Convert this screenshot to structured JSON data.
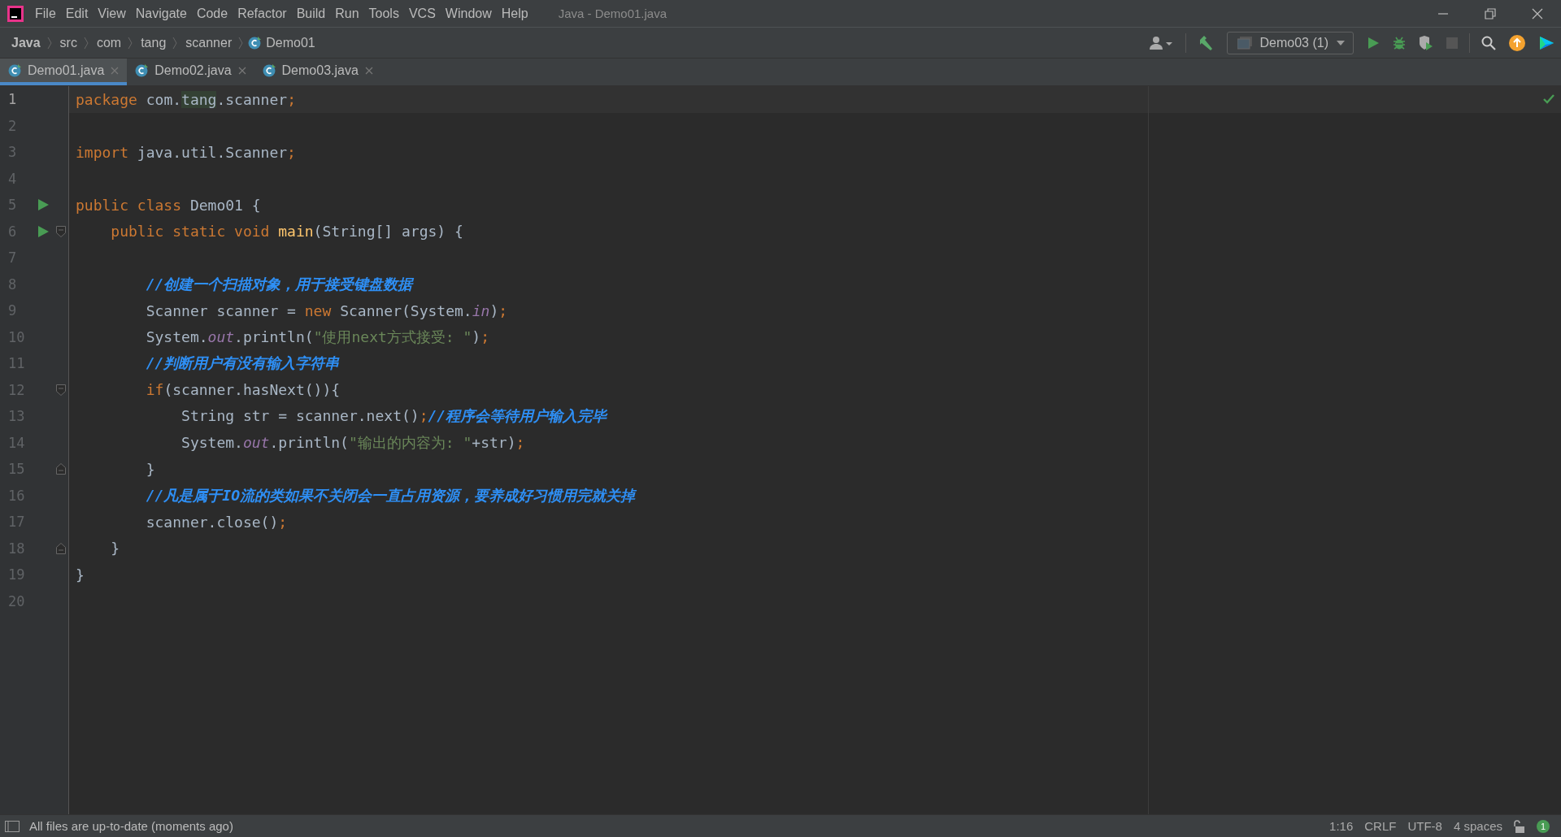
{
  "menu": [
    "File",
    "Edit",
    "View",
    "Navigate",
    "Code",
    "Refactor",
    "Build",
    "Run",
    "Tools",
    "VCS",
    "Window",
    "Help"
  ],
  "window": {
    "title": "Java - Demo01.java"
  },
  "breadcrumbs": [
    {
      "label": "Java",
      "kind": "project"
    },
    {
      "label": "src",
      "kind": "folder"
    },
    {
      "label": "com",
      "kind": "folder"
    },
    {
      "label": "tang",
      "kind": "folder"
    },
    {
      "label": "scanner",
      "kind": "folder"
    },
    {
      "label": "Demo01",
      "kind": "class"
    }
  ],
  "toolbar": {
    "run_config": "Demo03 (1)",
    "stop_disabled": true
  },
  "tabs": [
    {
      "label": "Demo01.java",
      "selected": true
    },
    {
      "label": "Demo02.java",
      "selected": false
    },
    {
      "label": "Demo03.java",
      "selected": false
    }
  ],
  "lines": [
    {
      "number": "1",
      "current": true,
      "tokens": [
        {
          "kind": "kw",
          "text": "package "
        },
        {
          "kind": "plain",
          "text": "com."
        },
        {
          "kind": "match",
          "text": "tang"
        },
        {
          "kind": "plain",
          "text": ".scanner"
        },
        {
          "kind": "semi",
          "text": ";"
        }
      ]
    },
    {
      "number": "2"
    },
    {
      "number": "3",
      "tokens": [
        {
          "kind": "kw",
          "text": "import "
        },
        {
          "kind": "plain",
          "text": "java.util.Scanner"
        },
        {
          "kind": "semi",
          "text": ";"
        }
      ]
    },
    {
      "number": "4"
    },
    {
      "number": "5",
      "run_marker": true,
      "tokens": [
        {
          "kind": "kw",
          "text": "public class "
        },
        {
          "kind": "plain",
          "text": "Demo01 {"
        }
      ]
    },
    {
      "number": "6",
      "run_marker": true,
      "fold_start": true,
      "tokens": [
        {
          "kind": "kw",
          "text": "    public static void "
        },
        {
          "kind": "method",
          "text": "main"
        },
        {
          "kind": "plain",
          "text": "(String[] args) {"
        }
      ]
    },
    {
      "number": "7"
    },
    {
      "number": "8",
      "tokens": [
        {
          "kind": "comment",
          "text": "        //创建一个扫描对象，用于接受键盘数据"
        }
      ]
    },
    {
      "number": "9",
      "tokens": [
        {
          "kind": "plain",
          "text": "        Scanner scanner = "
        },
        {
          "kind": "kw",
          "text": "new "
        },
        {
          "kind": "plain",
          "text": "Scanner(System."
        },
        {
          "kind": "field",
          "text": "in"
        },
        {
          "kind": "plain",
          "text": ")"
        },
        {
          "kind": "semi",
          "text": ";"
        }
      ]
    },
    {
      "number": "10",
      "tokens": [
        {
          "kind": "plain",
          "text": "        System."
        },
        {
          "kind": "field",
          "text": "out"
        },
        {
          "kind": "plain",
          "text": ".println("
        },
        {
          "kind": "string",
          "text": "\"使用next方式接受: \""
        },
        {
          "kind": "plain",
          "text": ")"
        },
        {
          "kind": "semi",
          "text": ";"
        }
      ]
    },
    {
      "number": "11",
      "tokens": [
        {
          "kind": "comment",
          "text": "        //判断用户有没有输入字符串"
        }
      ]
    },
    {
      "number": "12",
      "fold_start": true,
      "tokens": [
        {
          "kind": "kw",
          "text": "        if"
        },
        {
          "kind": "plain",
          "text": "(scanner.hasNext()){"
        }
      ]
    },
    {
      "number": "13",
      "tokens": [
        {
          "kind": "plain",
          "text": "            String str = scanner.next()"
        },
        {
          "kind": "semi",
          "text": ";"
        },
        {
          "kind": "comment",
          "text": "//程序会等待用户输入完毕"
        }
      ]
    },
    {
      "number": "14",
      "tokens": [
        {
          "kind": "plain",
          "text": "            System."
        },
        {
          "kind": "field",
          "text": "out"
        },
        {
          "kind": "plain",
          "text": ".println("
        },
        {
          "kind": "string",
          "text": "\"输出的内容为: \""
        },
        {
          "kind": "plain",
          "text": "+str)"
        },
        {
          "kind": "semi",
          "text": ";"
        }
      ]
    },
    {
      "number": "15",
      "fold_end": true,
      "tokens": [
        {
          "kind": "plain",
          "text": "        }"
        }
      ]
    },
    {
      "number": "16",
      "tokens": [
        {
          "kind": "comment",
          "text": "        //凡是属于IO流的类如果不关闭会一直占用资源，要养成好习惯用完就关掉"
        }
      ]
    },
    {
      "number": "17",
      "tokens": [
        {
          "kind": "plain",
          "text": "        scanner.close()"
        },
        {
          "kind": "semi",
          "text": ";"
        }
      ]
    },
    {
      "number": "18",
      "fold_end": true,
      "tokens": [
        {
          "kind": "plain",
          "text": "    }"
        }
      ]
    },
    {
      "number": "19",
      "tokens": [
        {
          "kind": "plain",
          "text": "}"
        }
      ]
    },
    {
      "number": "20"
    }
  ],
  "status_bar": {
    "message": "All files are up-to-date (moments ago)",
    "position": "1:16",
    "line_separator": "CRLF",
    "encoding": "UTF-8",
    "indent": "4 spaces",
    "notifications": "1"
  }
}
